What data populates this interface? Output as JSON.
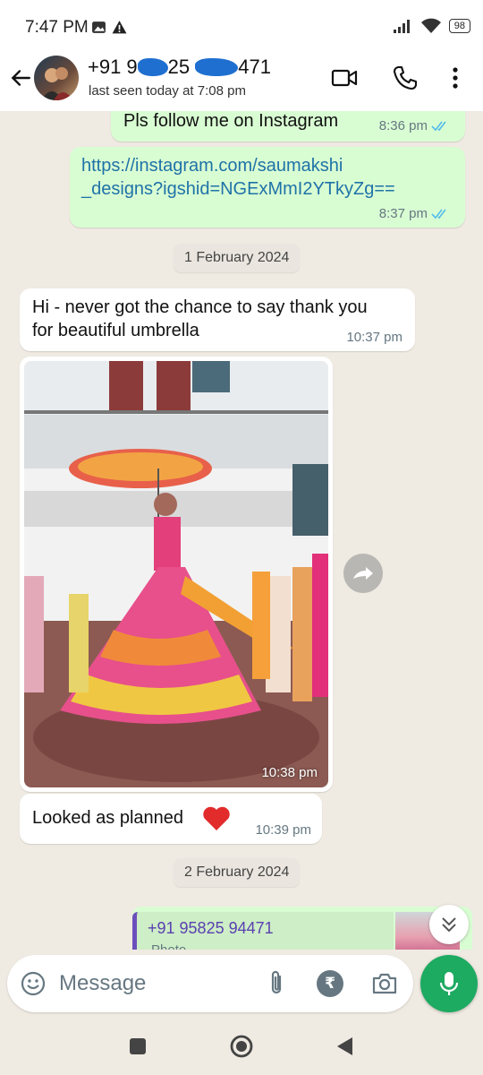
{
  "status_bar": {
    "time": "7:47 PM",
    "battery": "98"
  },
  "header": {
    "name_prefix": "+91 9",
    "name_mid": "25",
    "name_suffix": "471",
    "last_seen": "last seen today at 7:08 pm"
  },
  "messages": [
    {
      "id": "m1",
      "direction": "out",
      "text": "Pls follow me on Instagram",
      "time": "8:36 pm",
      "ticks": "read"
    },
    {
      "id": "m2",
      "direction": "out",
      "text_line1": "https://instagram.com/saumakshi",
      "text_line2": "_designs?igshid=NGExMmI2YTkyZg==",
      "time": "8:37 pm",
      "ticks": "read"
    },
    {
      "id": "d1",
      "type": "date",
      "text": "1 February 2024"
    },
    {
      "id": "m3",
      "direction": "in",
      "text_line1": "Hi - never got the chance to say thank you",
      "text_line2": "for beautiful umbrella",
      "time": "10:37 pm"
    },
    {
      "id": "m4",
      "direction": "in",
      "type": "photo",
      "time": "10:38 pm"
    },
    {
      "id": "m5",
      "direction": "in",
      "text": "Looked as planned",
      "emoji": "❤️",
      "time": "10:39 pm"
    },
    {
      "id": "d2",
      "type": "date",
      "text": "2 February 2024"
    },
    {
      "id": "m6",
      "direction": "out",
      "type": "reply",
      "quote_name": "+91 95825 94471",
      "quote_sub": "Photo"
    }
  ],
  "input": {
    "placeholder": "Message"
  },
  "colors": {
    "outgoing": "#d9fdd3",
    "incoming": "#ffffff",
    "accent": "#1daa61",
    "link": "#1f72a8",
    "tick": "#53bdeb"
  }
}
